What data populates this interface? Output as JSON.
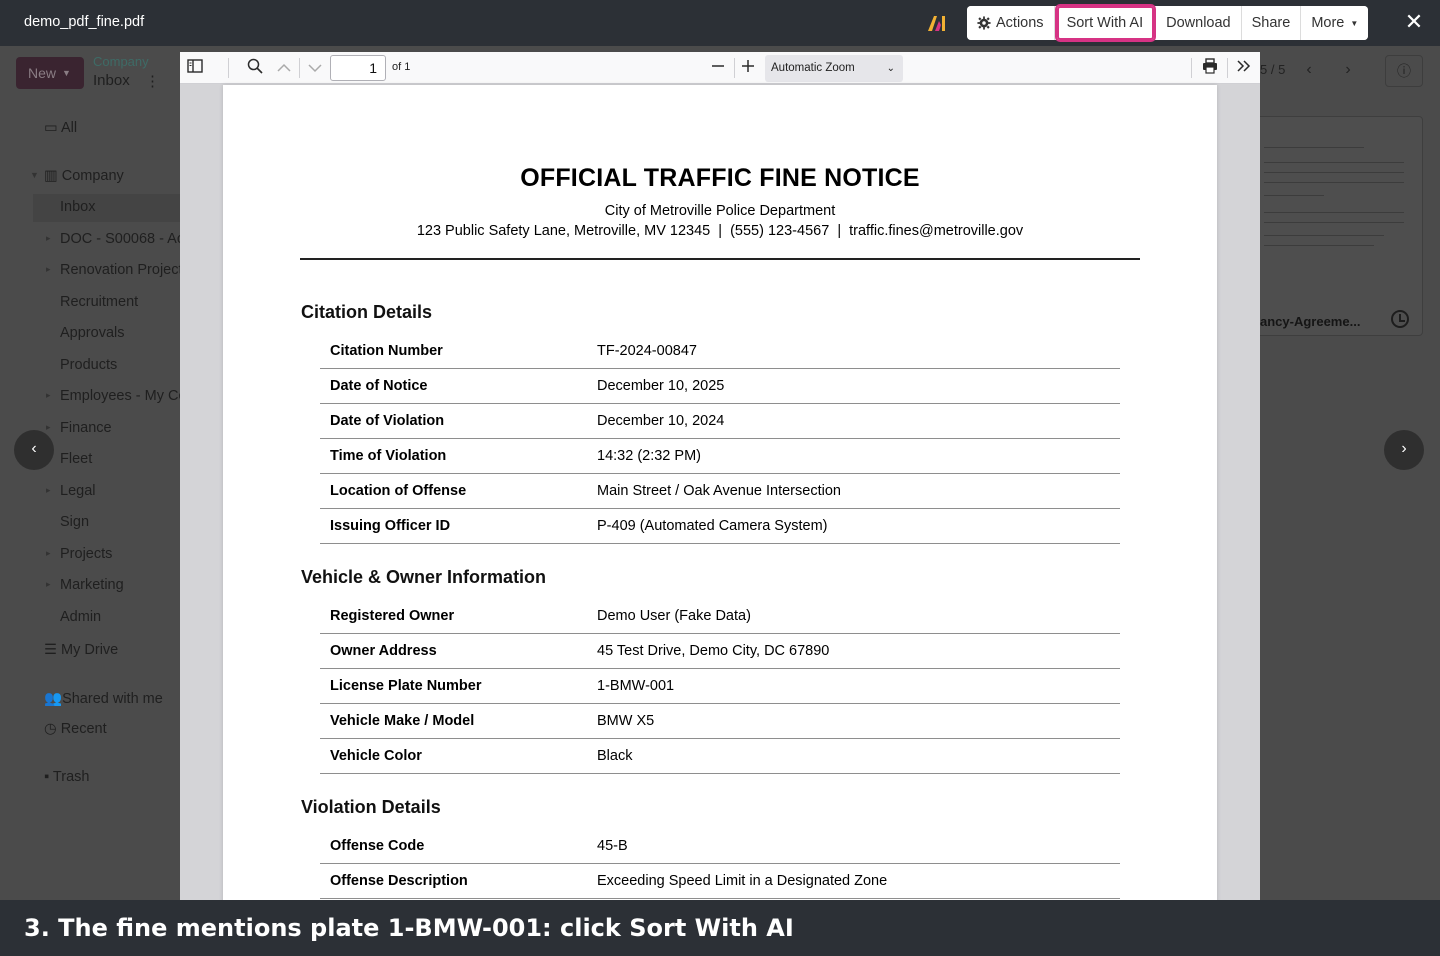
{
  "topbar": {
    "filename": "demo_pdf_fine.pdf",
    "buttons": {
      "actions": "Actions",
      "sort_with_ai": "Sort With AI",
      "download": "Download",
      "share": "Share",
      "more": "More"
    },
    "close": "✕"
  },
  "background": {
    "new_label": "New",
    "breadcrumb_parent": "Company",
    "breadcrumb_current": "Inbox",
    "tree": [
      {
        "label": "All"
      },
      {
        "label": "Company"
      },
      {
        "label": "Inbox"
      },
      {
        "label": "DOC - S00068 - Ac"
      },
      {
        "label": "Renovation Project"
      },
      {
        "label": "Recruitment"
      },
      {
        "label": "Approvals"
      },
      {
        "label": "Products"
      },
      {
        "label": "Employees - My Co"
      },
      {
        "label": "Finance"
      },
      {
        "label": "Fleet"
      },
      {
        "label": "Legal"
      },
      {
        "label": "Sign"
      },
      {
        "label": "Projects"
      },
      {
        "label": "Marketing"
      },
      {
        "label": "Admin"
      },
      {
        "label": "My Drive"
      },
      {
        "label": "Shared with me"
      },
      {
        "label": "Recent"
      },
      {
        "label": "Trash"
      }
    ],
    "pager": "5 / 5",
    "card_filename": "ancy-Agreeme..."
  },
  "viewer": {
    "page_number": "1",
    "page_of": "of 1",
    "zoom": "Automatic Zoom"
  },
  "document": {
    "title": "OFFICIAL TRAFFIC FINE NOTICE",
    "department": "City of Metroville Police Department",
    "contact": "123 Public Safety Lane, Metroville, MV 12345  |  (555) 123-4567  |  traffic.fines@metroville.gov",
    "sections": [
      {
        "heading": "Citation Details",
        "rows": [
          {
            "label": "Citation Number",
            "value": "TF-2024-00847"
          },
          {
            "label": "Date of Notice",
            "value": "December 10, 2025"
          },
          {
            "label": "Date of Violation",
            "value": "December 10, 2024"
          },
          {
            "label": "Time of Violation",
            "value": "14:32 (2:32 PM)"
          },
          {
            "label": "Location of Offense",
            "value": "Main Street / Oak Avenue Intersection"
          },
          {
            "label": "Issuing Officer ID",
            "value": "P-409 (Automated Camera System)"
          }
        ]
      },
      {
        "heading": "Vehicle & Owner Information",
        "rows": [
          {
            "label": "Registered Owner",
            "value": "Demo User (Fake Data)"
          },
          {
            "label": "Owner Address",
            "value": "45 Test Drive, Demo City, DC 67890"
          },
          {
            "label": "License Plate Number",
            "value": "1-BMW-001"
          },
          {
            "label": "Vehicle Make / Model",
            "value": "BMW X5"
          },
          {
            "label": "Vehicle Color",
            "value": "Black"
          }
        ]
      },
      {
        "heading": "Violation Details",
        "rows": [
          {
            "label": "Offense Code",
            "value": "45-B"
          },
          {
            "label": "Offense Description",
            "value": "Exceeding Speed Limit in a Designated Zone"
          }
        ]
      }
    ]
  },
  "caption": "3. The fine mentions plate 1-BMW-001: click Sort With AI",
  "colors": {
    "topbar_bg": "#2c3036",
    "highlight": "#d63384",
    "overlay_bg": "#4b4b4b"
  }
}
